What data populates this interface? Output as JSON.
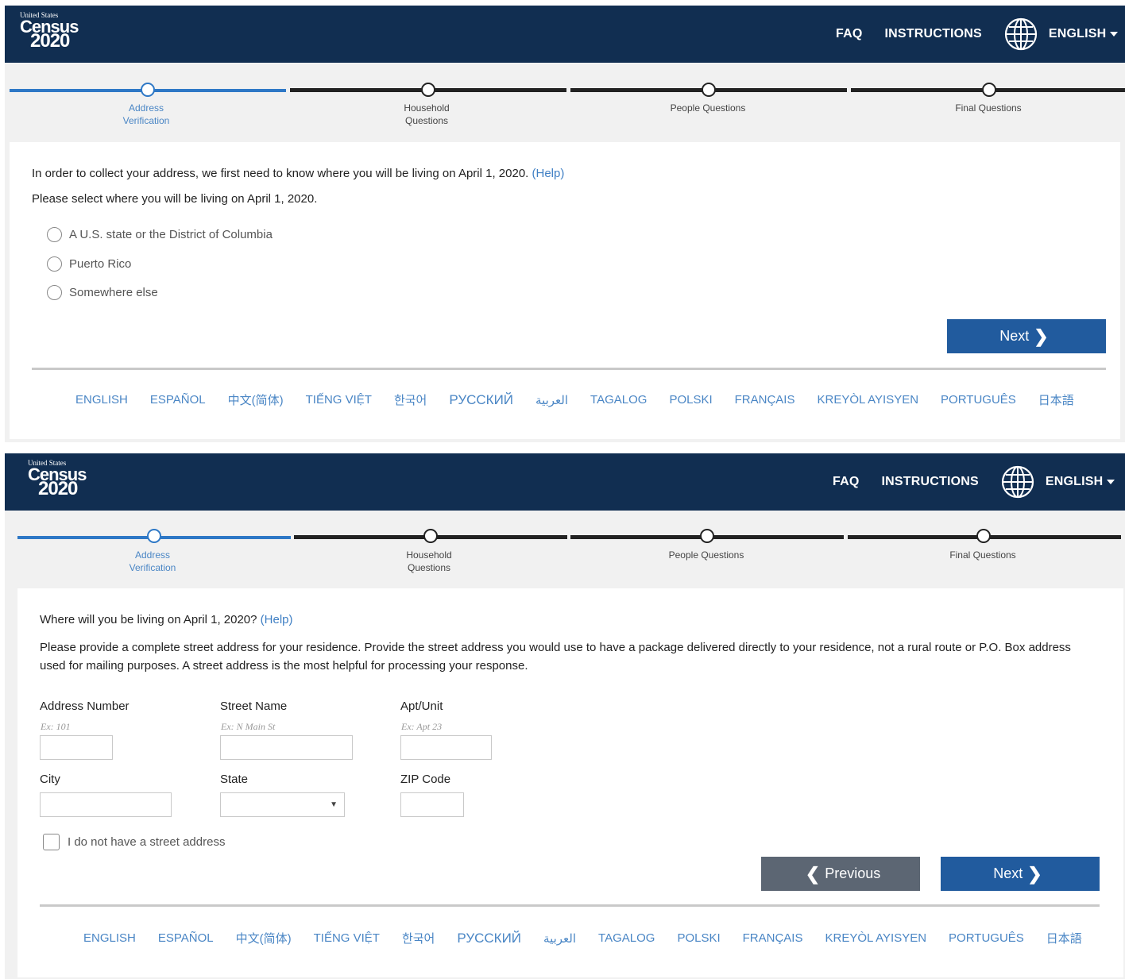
{
  "header": {
    "logo_line1": "United States",
    "logo_line2": "Census",
    "logo_line3": "2020",
    "faq": "FAQ",
    "instructions": "INSTRUCTIONS",
    "language": "ENGLISH",
    "icons": {
      "globe": "globe-icon",
      "caret": "caret-down-icon"
    }
  },
  "steps": [
    {
      "label_line1": "Address",
      "label_line2": "Verification",
      "active": true
    },
    {
      "label_line1": "Household",
      "label_line2": "Questions",
      "active": false
    },
    {
      "label_line1": "People Questions",
      "label_line2": "",
      "active": false
    },
    {
      "label_line1": "Final Questions",
      "label_line2": "",
      "active": false
    }
  ],
  "screen1": {
    "intro": "In order to collect your address, we first need to know where you will be living on April 1, 2020.",
    "help": "(Help)",
    "prompt": "Please select where you will be living on April 1, 2020.",
    "options": [
      "A U.S. state or the District of Columbia",
      "Puerto Rico",
      "Somewhere else"
    ],
    "next": "Next"
  },
  "screen2": {
    "question": "Where will you be living on April 1, 2020?",
    "help": "(Help)",
    "instruction_line1": "Please provide a complete street address for your residence. Provide the street address you would use to have a package delivered directly to your residence, not a rural route or P.O. Box address",
    "instruction_line2": "used for mailing purposes. A street address is the most helpful for processing your response.",
    "fields": {
      "address_number": {
        "label": "Address Number",
        "placeholder": "Ex: 101",
        "value": ""
      },
      "street_name": {
        "label": "Street Name",
        "placeholder": "Ex: N Main St",
        "value": ""
      },
      "apt_unit": {
        "label": "Apt/Unit",
        "placeholder": "Ex: Apt 23",
        "value": ""
      },
      "city": {
        "label": "City",
        "value": ""
      },
      "state": {
        "label": "State",
        "value": ""
      },
      "zip": {
        "label": "ZIP Code",
        "value": ""
      }
    },
    "no_street_address": "I do not have a street address",
    "previous": "Previous",
    "next": "Next"
  },
  "languages": [
    "ENGLISH",
    "ESPAÑOL",
    "中文(简体)",
    "TIẾNG VIỆT",
    "한국어",
    "РУССКИЙ",
    "العربية",
    "TAGALOG",
    "POLSKI",
    "FRANÇAIS",
    "KREYÒL AYISYEN",
    "PORTUGUÊS",
    "日本語"
  ],
  "colors": {
    "header_bg": "#112e51",
    "accent_blue": "#2e78c6",
    "next_button": "#215b9e",
    "prev_button": "#5c6673",
    "link_blue": "#4a86c5"
  }
}
